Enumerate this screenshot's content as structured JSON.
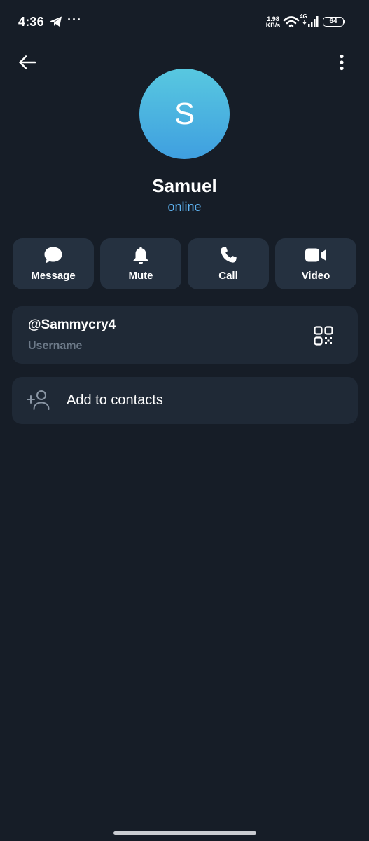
{
  "status_bar": {
    "time": "4:36",
    "dots": "···",
    "speed_value": "1.98",
    "speed_unit": "KB/s",
    "network": "4G",
    "battery": "64"
  },
  "profile": {
    "initial": "S",
    "name": "Samuel",
    "status": "online",
    "avatar_colors": [
      "#58c8e0",
      "#3f9fe0"
    ],
    "status_color": "#5fb4f2"
  },
  "actions": [
    {
      "label": "Message",
      "icon": "chat-bubble-icon"
    },
    {
      "label": "Mute",
      "icon": "bell-icon"
    },
    {
      "label": "Call",
      "icon": "phone-icon"
    },
    {
      "label": "Video",
      "icon": "video-camera-icon"
    }
  ],
  "username": {
    "value": "@Sammycry4",
    "label": "Username",
    "icon": "qr-code-icon"
  },
  "add_contact": {
    "label": "Add to contacts",
    "icon": "add-person-icon"
  },
  "theme": {
    "background": "#161d27",
    "card": "#1f2936",
    "button": "#253140",
    "muted_text": "#6d7a89"
  }
}
